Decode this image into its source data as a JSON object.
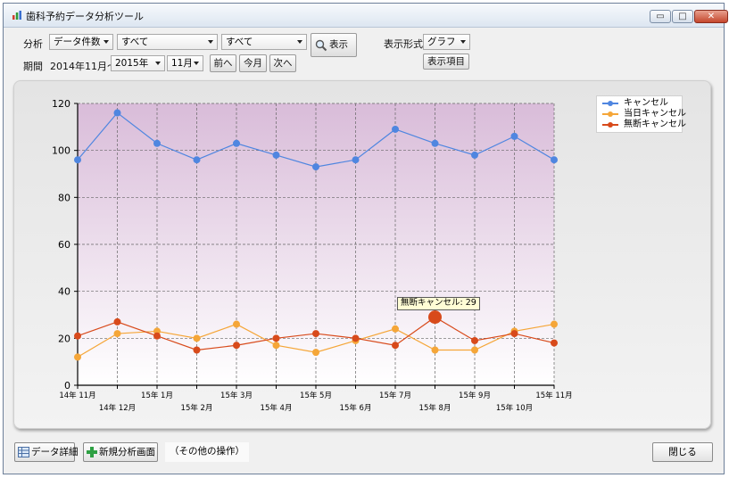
{
  "window": {
    "title": "歯科予約データ分析ツール",
    "controls": {
      "minimize": "▭",
      "maximize": "□",
      "close": "✕"
    }
  },
  "toolbar": {
    "analysis_label": "分析",
    "analysis_select": "データ件数",
    "filter1_select": "すべて",
    "filter2_select": "すべて",
    "show_button": "表示",
    "display_format_label": "表示形式",
    "display_format_select": "グラフ",
    "display_items_button": "表示項目",
    "period_label": "期間",
    "period_start": "2014年11月～",
    "year_select": "2015年",
    "month_select": "11月",
    "prev_button": "前へ",
    "this_month_button": "今月",
    "next_button": "次へ"
  },
  "legend": {
    "items": [
      {
        "label": "キャンセル",
        "color": "#4f86e0"
      },
      {
        "label": "当日キャンセル",
        "color": "#f5a638"
      },
      {
        "label": "無断キャンセル",
        "color": "#d84a1b"
      }
    ]
  },
  "tooltip": {
    "text": "無断キャンセル: 29"
  },
  "chart_data": {
    "type": "line",
    "categories": [
      "14年 11月",
      "14年 12月",
      "15年 1月",
      "15年 2月",
      "15年 3月",
      "15年 4月",
      "15年 5月",
      "15年 6月",
      "15年 7月",
      "15年 8月",
      "15年 9月",
      "15年 10月",
      "15年 11月"
    ],
    "series": [
      {
        "name": "キャンセル",
        "color": "#4f86e0",
        "values": [
          96,
          116,
          103,
          96,
          103,
          98,
          93,
          96,
          109,
          103,
          98,
          106,
          96
        ]
      },
      {
        "name": "当日キャンセル",
        "color": "#f5a638",
        "values": [
          12,
          22,
          23,
          20,
          26,
          17,
          14,
          19,
          24,
          15,
          15,
          23,
          26
        ]
      },
      {
        "name": "無断キャンセル",
        "color": "#d84a1b",
        "values": [
          21,
          27,
          21,
          15,
          17,
          20,
          22,
          20,
          17,
          29,
          19,
          22,
          18
        ]
      }
    ],
    "ylim": [
      0,
      120
    ],
    "yticks": [
      0,
      20,
      40,
      60,
      80,
      100,
      120
    ],
    "grid": true,
    "legend_position": "top-right",
    "highlight": {
      "series": "無断キャンセル",
      "category": "15年 8月",
      "value": 29
    }
  },
  "bottom": {
    "data_detail_button": "データ詳細",
    "new_analysis_button": "新規分析画面",
    "other_operations": "（その他の操作）",
    "close_button": "閉じる"
  }
}
